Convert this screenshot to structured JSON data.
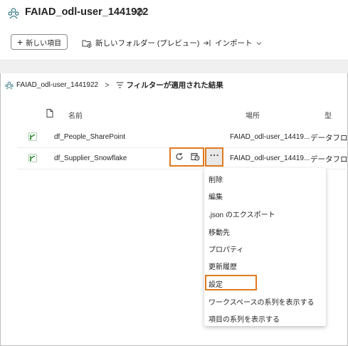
{
  "workspace": {
    "title": "FAIAD_odl-user_1441922"
  },
  "toolbar": {
    "new_item": "新しい項目",
    "new_folder": "新しいフォルダー (プレビュー)",
    "import": "インポート"
  },
  "breadcrumb": {
    "workspace": "FAIAD_odl-user_1441922",
    "separator": ">",
    "filter_label": "フィルターが適用された結果"
  },
  "table": {
    "columns": {
      "name": "名前",
      "location": "場所",
      "type": "型"
    },
    "rows": [
      {
        "name": "df_People_SharePoint",
        "location": "FAIAD_odl-user_14419...",
        "type": "データフロー"
      },
      {
        "name": "df_Supplier_Snowflake",
        "location": "FAIAD_odl-user_14419...",
        "type": "データフロー"
      }
    ]
  },
  "context_menu": {
    "items": [
      "削除",
      "編集",
      ".json のエクスポート",
      "移動先",
      "プロパティ",
      "更新履歴",
      "設定",
      "ワークスペースの系列を表示する",
      "項目の系列を表示する"
    ]
  },
  "colors": {
    "highlight": "#e07a1f",
    "dataflow_icon": "#107c10"
  },
  "icons": [
    "workspace-icon",
    "diamond-icon",
    "plus-icon",
    "folder-add-icon",
    "import-icon",
    "chevron-down-icon",
    "filter-icon",
    "document-icon",
    "dataflow-icon",
    "refresh-icon",
    "schedule-icon",
    "more-icon"
  ]
}
